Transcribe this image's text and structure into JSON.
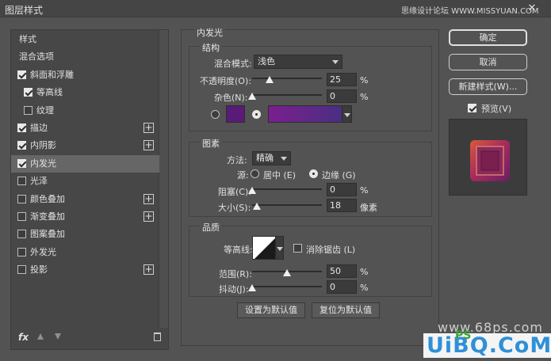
{
  "window": {
    "title": "图层样式",
    "top_watermark": "思缘设计论坛 WWW.MISSYUAN.COM",
    "close_glyph": "✕"
  },
  "style_list": {
    "items": [
      {
        "label": "样式",
        "checkbox": null,
        "plus": false,
        "indent": "plain"
      },
      {
        "label": "混合选项",
        "checkbox": null,
        "plus": false,
        "indent": "plain"
      },
      {
        "label": "斜面和浮雕",
        "checkbox": true,
        "plus": false,
        "indent": "top"
      },
      {
        "label": "等高线",
        "checkbox": true,
        "plus": false,
        "indent": "sub"
      },
      {
        "label": "纹理",
        "checkbox": false,
        "plus": false,
        "indent": "sub"
      },
      {
        "label": "描边",
        "checkbox": true,
        "plus": true,
        "indent": "top"
      },
      {
        "label": "内阴影",
        "checkbox": true,
        "plus": true,
        "indent": "top"
      },
      {
        "label": "内发光",
        "checkbox": true,
        "plus": false,
        "indent": "top",
        "selected": true
      },
      {
        "label": "光泽",
        "checkbox": false,
        "plus": false,
        "indent": "top"
      },
      {
        "label": "颜色叠加",
        "checkbox": false,
        "plus": true,
        "indent": "top"
      },
      {
        "label": "渐变叠加",
        "checkbox": false,
        "plus": true,
        "indent": "top"
      },
      {
        "label": "图案叠加",
        "checkbox": false,
        "plus": false,
        "indent": "top"
      },
      {
        "label": "外发光",
        "checkbox": false,
        "plus": false,
        "indent": "top"
      },
      {
        "label": "投影",
        "checkbox": false,
        "plus": true,
        "indent": "top"
      }
    ],
    "fx_label": "fx"
  },
  "inner_glow": {
    "title": "内发光",
    "structure": {
      "title": "结构",
      "blend_mode_label": "混合模式:",
      "blend_mode_value": "浅色",
      "opacity_label": "不透明度(O):",
      "opacity_value": "25",
      "opacity_fraction": 0.25,
      "noise_label": "杂色(N):",
      "noise_value": "0",
      "noise_fraction": 0.0,
      "percent": "%",
      "color": "#5a1a78",
      "gradient_from": "#7a1f8e",
      "gradient_to": "#4a2f82"
    },
    "elements": {
      "title": "图素",
      "method_label": "方法:",
      "method_value": "精确",
      "source_label": "源:",
      "source_center": "居中 (E)",
      "source_edge": "边缘 (G)",
      "choke_label": "阻塞(C):",
      "choke_value": "0",
      "choke_fraction": 0.0,
      "size_label": "大小(S):",
      "size_value": "18",
      "size_fraction": 0.072,
      "size_unit": "像素",
      "percent": "%"
    },
    "quality": {
      "title": "品质",
      "contour_label": "等高线:",
      "antialias_label": "消除锯齿 (L)",
      "range_label": "范围(R):",
      "range_value": "50",
      "range_fraction": 0.5,
      "jitter_label": "抖动(J):",
      "jitter_value": "0",
      "jitter_fraction": 0.0,
      "percent": "%"
    },
    "set_default": "设置为默认值",
    "reset_default": "复位为默认值"
  },
  "right_buttons": {
    "ok": "确定",
    "cancel": "取消",
    "new_style": "新建样式(W)...",
    "preview_label": "预览(V)",
    "preview_checked": true
  },
  "watermarks": {
    "site_68ps": "www.68ps.com",
    "uibq": "UiBQ.CoM",
    "ps": "PS"
  }
}
